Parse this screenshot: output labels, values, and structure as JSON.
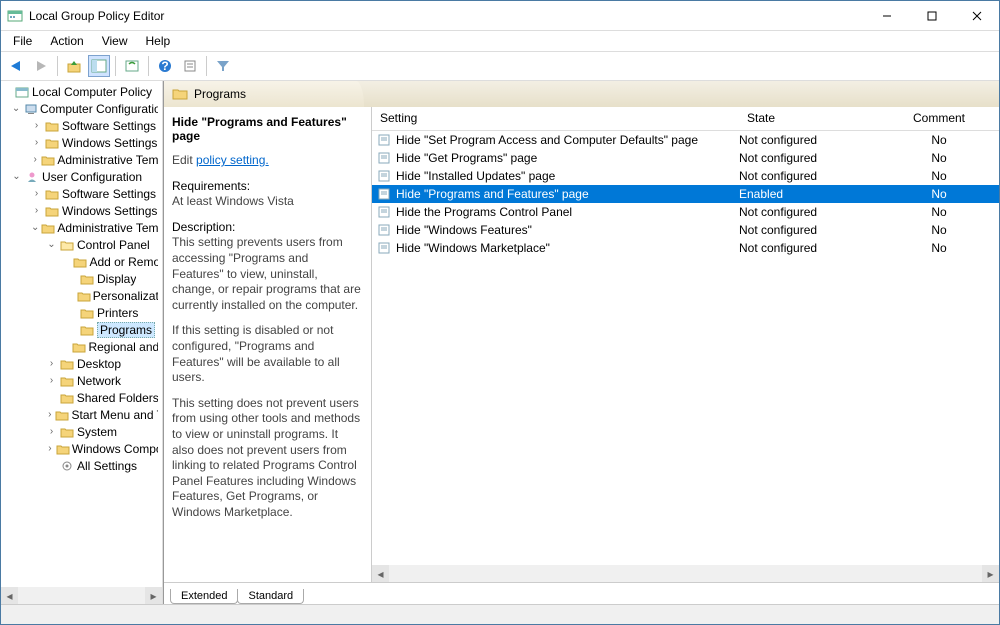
{
  "titlebar": {
    "title": "Local Group Policy Editor"
  },
  "menubar": {
    "items": [
      "File",
      "Action",
      "View",
      "Help"
    ]
  },
  "tree": {
    "root": "Local Computer Policy",
    "computer_cfg": "Computer Configuration",
    "cc_soft": "Software Settings",
    "cc_win": "Windows Settings",
    "cc_adm": "Administrative Templates",
    "user_cfg": "User Configuration",
    "uc_soft": "Software Settings",
    "uc_win": "Windows Settings",
    "uc_adm": "Administrative Templates",
    "cp": "Control Panel",
    "cp_addrem": "Add or Remove Programs",
    "cp_display": "Display",
    "cp_personal": "Personalization",
    "cp_printers": "Printers",
    "cp_programs": "Programs",
    "cp_regional": "Regional and Language Options",
    "desktop": "Desktop",
    "network": "Network",
    "shared": "Shared Folders",
    "startmenu": "Start Menu and Taskbar",
    "system": "System",
    "wincomp": "Windows Components",
    "allset": "All Settings"
  },
  "breadcrumb": {
    "title": "Programs"
  },
  "desc": {
    "heading": "Hide \"Programs and Features\" page",
    "edit_prefix": "Edit ",
    "edit_link": "policy setting.",
    "req_label": "Requirements:",
    "req_text": "At least Windows Vista",
    "desc_label": "Description:",
    "p1": "This setting prevents users from accessing \"Programs and Features\" to view, uninstall, change, or repair programs that are currently installed on the computer.",
    "p2": "If this setting is disabled or not configured, \"Programs and Features\" will be available to all users.",
    "p3": "This setting does not prevent users from using other tools and methods to view or uninstall programs.  It also does not prevent users from linking to related Programs Control Panel Features including Windows Features, Get Programs, or Windows Marketplace."
  },
  "list": {
    "cols": {
      "setting": "Setting",
      "state": "State",
      "comment": "Comment"
    },
    "rows": [
      {
        "setting": "Hide \"Set Program Access and Computer Defaults\" page",
        "state": "Not configured",
        "comment": "No",
        "selected": false
      },
      {
        "setting": "Hide \"Get Programs\" page",
        "state": "Not configured",
        "comment": "No",
        "selected": false
      },
      {
        "setting": "Hide \"Installed Updates\" page",
        "state": "Not configured",
        "comment": "No",
        "selected": false
      },
      {
        "setting": "Hide \"Programs and Features\" page",
        "state": "Enabled",
        "comment": "No",
        "selected": true
      },
      {
        "setting": "Hide the Programs Control Panel",
        "state": "Not configured",
        "comment": "No",
        "selected": false
      },
      {
        "setting": "Hide \"Windows Features\"",
        "state": "Not configured",
        "comment": "No",
        "selected": false
      },
      {
        "setting": "Hide \"Windows Marketplace\"",
        "state": "Not configured",
        "comment": "No",
        "selected": false
      }
    ]
  },
  "tabs": {
    "extended": "Extended",
    "standard": "Standard"
  }
}
